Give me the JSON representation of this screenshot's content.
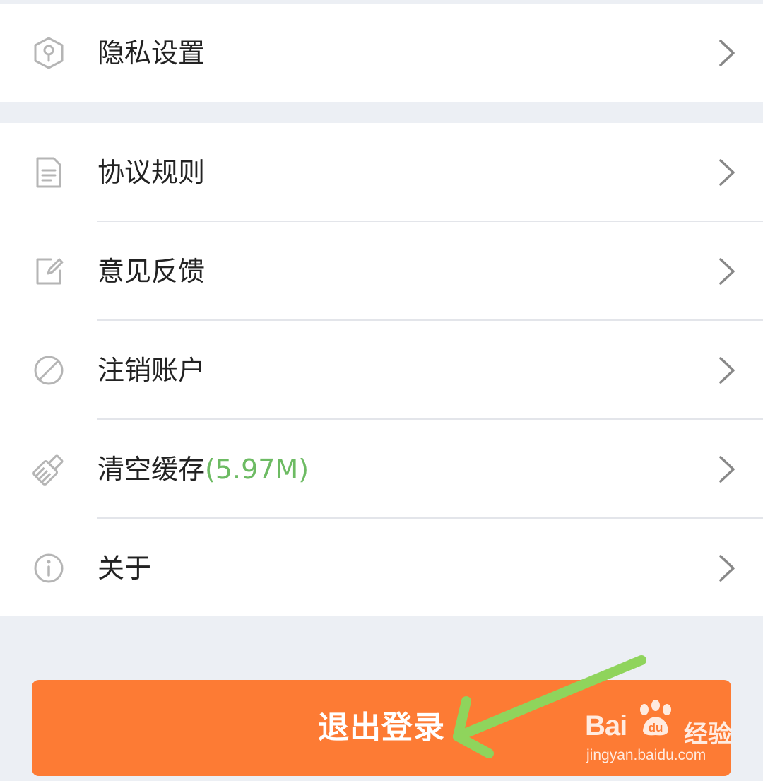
{
  "privacy_section": {
    "items": [
      {
        "label": "隐私设置",
        "icon": "privacy-shield-icon"
      }
    ]
  },
  "settings_section": {
    "items": [
      {
        "label": "协议规则",
        "icon": "document-icon"
      },
      {
        "label": "意见反馈",
        "icon": "edit-icon"
      },
      {
        "label": "注销账户",
        "icon": "prohibit-icon"
      },
      {
        "label": "清空缓存",
        "size": "(5.97M)",
        "icon": "broom-icon"
      },
      {
        "label": "关于",
        "icon": "info-icon"
      }
    ]
  },
  "logout": {
    "label": "退出登录"
  },
  "watermark": {
    "brand": "Bai",
    "brand_suffix": "经验",
    "url": "jingyan.baidu.com"
  },
  "colors": {
    "background": "#eceff4",
    "card": "#ffffff",
    "text": "#222222",
    "cache_size": "#6dbb63",
    "logout_button": "#fd7b34",
    "annotation_arrow": "#8fd45c",
    "icon_gray": "#b5b5b5"
  }
}
